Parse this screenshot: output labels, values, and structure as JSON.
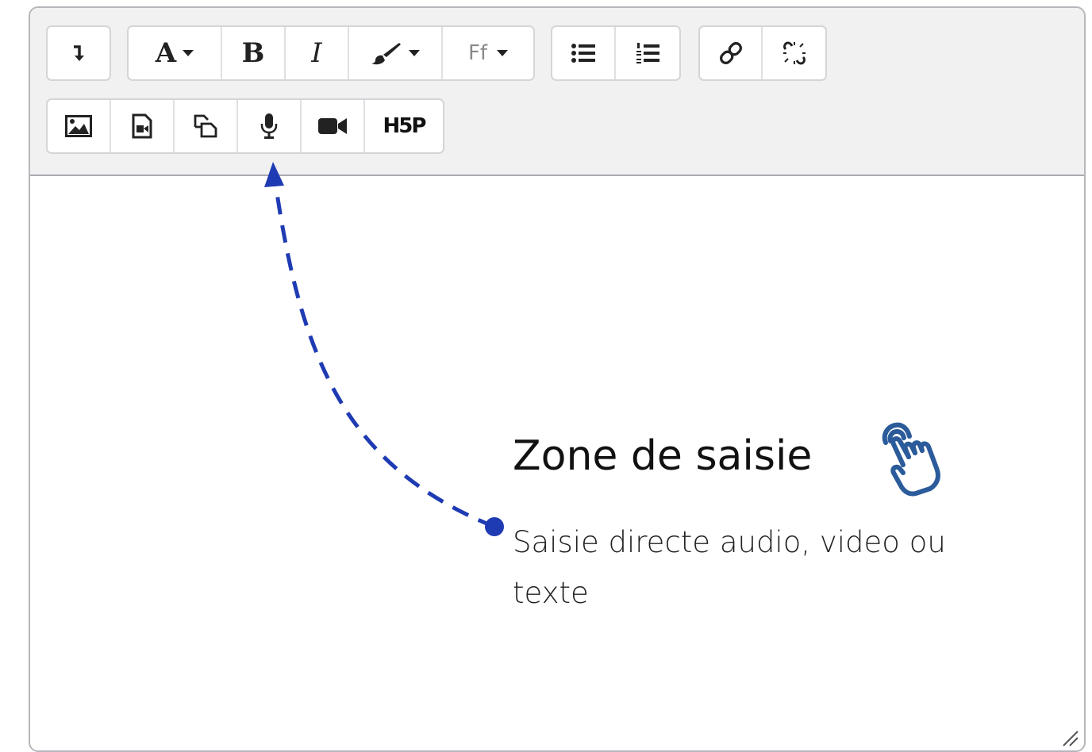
{
  "toolbar": {
    "row1": {
      "expand": {
        "icon": "expand-arrow-icon"
      },
      "paragraph_style": {
        "label": "A",
        "icon": "heading-style-icon"
      },
      "bold": {
        "label": "B"
      },
      "italic": {
        "label": "I"
      },
      "text_color": {
        "icon": "paint-brush-icon"
      },
      "font_family": {
        "label": "Ff"
      },
      "unordered_list": {
        "icon": "bullet-list-icon"
      },
      "ordered_list": {
        "icon": "numbered-list-icon"
      },
      "link": {
        "icon": "link-icon"
      },
      "unlink": {
        "icon": "unlink-icon"
      }
    },
    "row2": {
      "image": {
        "icon": "image-icon"
      },
      "media": {
        "icon": "media-file-icon"
      },
      "manage_files": {
        "icon": "manage-files-icon"
      },
      "record_audio": {
        "icon": "microphone-icon"
      },
      "record_video": {
        "icon": "video-camera-icon"
      },
      "h5p": {
        "label": "H5P"
      }
    }
  },
  "annotation": {
    "title": "Zone de saisie",
    "subtitle": "Saisie directe audio, video ou texte",
    "pointer_icon": "hand-pointer-icon",
    "arrow_color": "#1f3bb3",
    "hand_color": "#2b5b9a"
  }
}
